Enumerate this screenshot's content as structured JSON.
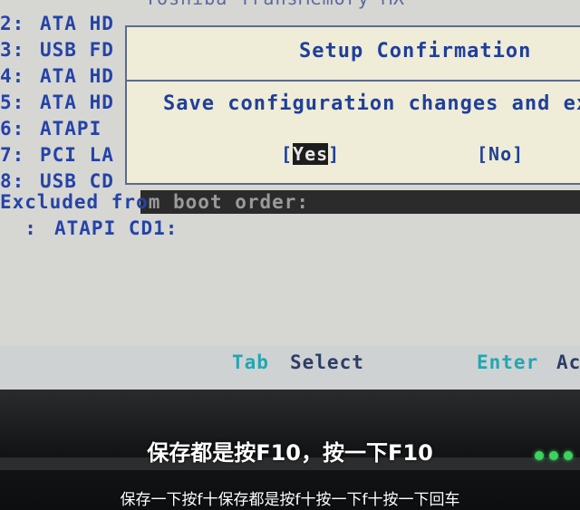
{
  "screen": {
    "partial_top_text": "Toshiba TransMemory-MX",
    "boot_order": [
      {
        "index": "2:",
        "label": "ATA HD"
      },
      {
        "index": "3:",
        "label": "USB FD"
      },
      {
        "index": "4:",
        "label": "ATA HD"
      },
      {
        "index": "5:",
        "label": "ATA HD"
      },
      {
        "index": "6:",
        "label": "ATAPI"
      },
      {
        "index": "7:",
        "label": "PCI LA"
      },
      {
        "index": "8:",
        "label": "USB CD"
      }
    ],
    "excluded_header_prefix": "Excluded fro",
    "excluded_header_rest": "m boot order:",
    "excluded_items": [
      {
        "index": ":",
        "label": "ATAPI CD1:"
      }
    ]
  },
  "dialog": {
    "title": "Setup Confirmation",
    "message": "Save configuration changes and exi",
    "yes_bracket_open": "[",
    "yes_label": "Yes",
    "yes_bracket_close": "]",
    "no_label": "[No]"
  },
  "footer": {
    "tab_key": "Tab",
    "tab_desc": "Select",
    "enter_key": "Enter",
    "enter_desc": "Ac"
  },
  "subtitles": {
    "main": "保存都是按F10，按一下F10",
    "small": "保存一下按f十保存都是按f十按一下f十按一下回车"
  },
  "colors": {
    "bios_bg": "#d6d6d3",
    "bios_text": "#2443a8",
    "dialog_bg": "#efecd8",
    "key_accent": "#22a6b3"
  }
}
